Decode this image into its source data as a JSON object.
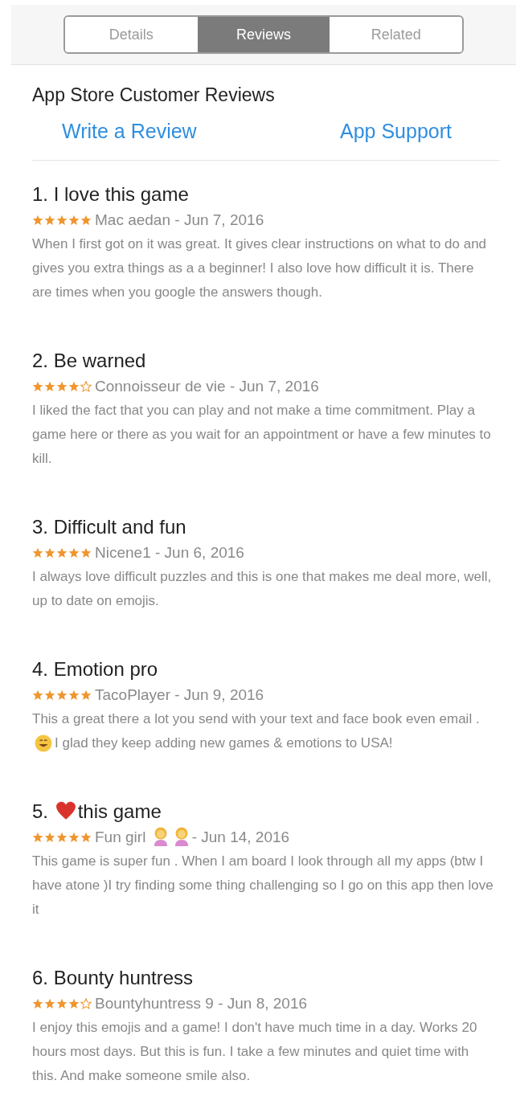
{
  "tabs": [
    {
      "label": "Details",
      "selected": false
    },
    {
      "label": "Reviews",
      "selected": true
    },
    {
      "label": "Related",
      "selected": false
    }
  ],
  "heading": "App Store Customer Reviews",
  "links": [
    "Write a Review",
    "App Support"
  ],
  "reviews": [
    {
      "title": [
        {
          "kind": "text",
          "text": "1. I love this game"
        }
      ],
      "stars": 5,
      "byline": [
        {
          "kind": "text",
          "text": "Mac aedan - Jun 7, 2016"
        }
      ],
      "body": [
        {
          "kind": "text",
          "text": "When I first got on it was great. It gives clear instructions on what to do and gives you extra things as a a beginner! I also love how difficult it is. There are times when you google the answers though."
        }
      ]
    },
    {
      "title": [
        {
          "kind": "text",
          "text": "2. Be warned"
        }
      ],
      "stars": 4,
      "byline": [
        {
          "kind": "text",
          "text": "Connoisseur de vie - Jun 7, 2016"
        }
      ],
      "body": [
        {
          "kind": "text",
          "text": "I liked the fact that you can play and not make a time commitment. Play a game here or there as you wait for an appointment or have a few minutes to kill."
        }
      ]
    },
    {
      "title": [
        {
          "kind": "text",
          "text": "3. Difficult and fun"
        }
      ],
      "stars": 5,
      "byline": [
        {
          "kind": "text",
          "text": "Nicene1 - Jun 6, 2016"
        }
      ],
      "body": [
        {
          "kind": "text",
          "text": "I always love difficult puzzles and this is one that makes me deal more, well, up to date on emojis."
        }
      ]
    },
    {
      "title": [
        {
          "kind": "text",
          "text": "4. Emotion pro"
        }
      ],
      "stars": 5,
      "byline": [
        {
          "kind": "text",
          "text": "TacoPlayer - Jun 9, 2016"
        }
      ],
      "body": [
        {
          "kind": "text",
          "text": "This a great there a lot you send with your text and face"
        },
        {
          "kind": "text",
          "text": "book even email ."
        },
        {
          "kind": "smiley"
        },
        {
          "kind": "text",
          "text": "I glad they keep adding new games &"
        },
        {
          "kind": "text",
          "text": "emotions to USA!"
        }
      ]
    },
    {
      "title": [
        {
          "kind": "text",
          "text": "5."
        },
        {
          "kind": "heart"
        },
        {
          "kind": "text",
          "text": "this game"
        }
      ],
      "stars": 5,
      "byline": [
        {
          "kind": "text",
          "text": "Fun girl"
        },
        {
          "kind": "person"
        },
        {
          "kind": "person"
        },
        {
          "kind": "text",
          "text": "- Jun 14, 2016"
        }
      ],
      "body": [
        {
          "kind": "text",
          "text": "This game is super fun . When I am board I look through all my apps (btw I have atone )I try finding some thing challenging so I go on this app then love it"
        }
      ]
    },
    {
      "title": [
        {
          "kind": "text",
          "text": "6. Bounty huntress"
        }
      ],
      "stars": 4,
      "byline": [
        {
          "kind": "text",
          "text": "Bountyhuntress 9 - Jun 8, 2016"
        }
      ],
      "body": [
        {
          "kind": "text",
          "text": "I enjoy this emojis and a game! I don't have much time in a day. Works 20 hours most days. But this is fun. I take a few minutes and quiet time with this. And make someone smile also."
        }
      ]
    }
  ]
}
